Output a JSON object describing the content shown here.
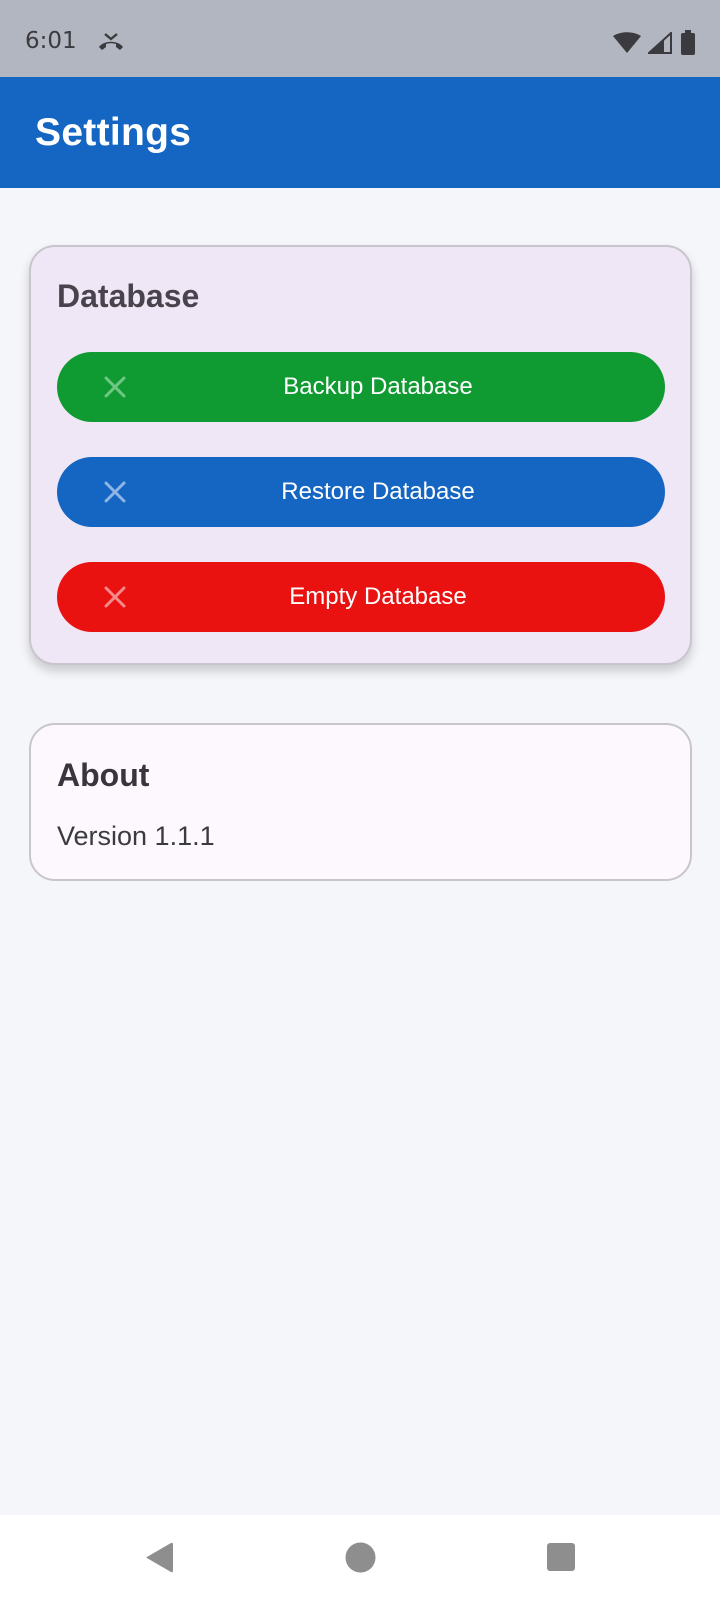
{
  "status_bar": {
    "time": "6:01",
    "icons": [
      "missed-call-icon",
      "wifi-icon",
      "signal-icon",
      "battery-icon"
    ]
  },
  "app_bar": {
    "title": "Settings",
    "color": "#1565c2"
  },
  "database_card": {
    "title": "Database",
    "buttons": [
      {
        "label": "Backup Database",
        "icon": "close-icon",
        "color": "#0f9a32",
        "icon_color": "#6fc784"
      },
      {
        "label": "Restore Database",
        "icon": "close-icon",
        "color": "#1565c2",
        "icon_color": "#8fb4e6"
      },
      {
        "label": "Empty Database",
        "icon": "close-icon",
        "color": "#ea1111",
        "icon_color": "#f58a8a"
      }
    ]
  },
  "about_card": {
    "title": "About",
    "version": "Version 1.1.1"
  },
  "nav_bar": {
    "icons": [
      "back-icon",
      "home-icon",
      "recents-icon"
    ]
  }
}
